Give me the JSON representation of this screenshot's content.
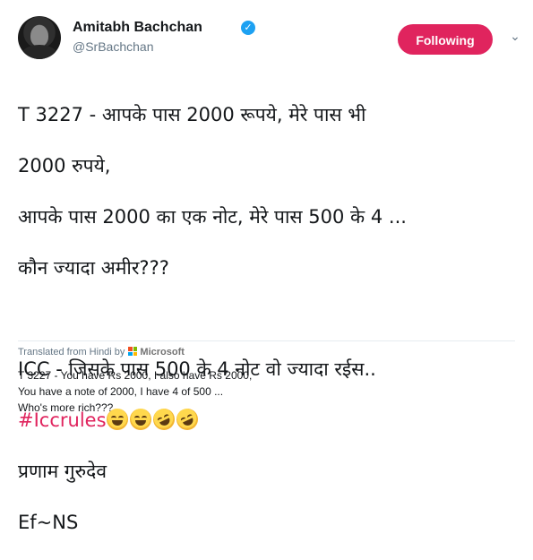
{
  "profile": {
    "name": "Amitabh Bachchan",
    "handle": "@SrBachchan",
    "follow_label": "Following"
  },
  "tweet": {
    "lines": [
      "T 3227 - आपके पास 2000 रूपये,  मेरे पास भी",
      "2000 रुपये,",
      "आपके पास 2000 का एक नोट, मेरे पास 500 के 4 ...",
      "कौन ज्यादा अमीर???",
      "ICC - जिसके पास 500 के 4 नोट वो ज्यादा रईस..",
      "प्रणाम गुरुदेव",
      "Ef~NS"
    ],
    "hashtag": "#Iccrules",
    "emojis": [
      "face-with-tears-of-joy",
      "face-with-tears-of-joy",
      "rolling-on-the-floor-laughing",
      "rolling-on-the-floor-laughing"
    ]
  },
  "translation": {
    "prefix": "Translated from Hindi by",
    "provider": "Microsoft",
    "lines": [
      "T 3227 - You have Rs 2000, I also have Rs 2000,",
      "You have a note of 2000, I have 4 of 500 ...",
      "Who's more rich???"
    ]
  },
  "colors": {
    "accent": "#e0245e",
    "verified": "#1da1f2",
    "muted": "#657786"
  },
  "icons": {
    "verified": "verified-badge-icon",
    "caret": "chevron-down-icon",
    "provider": "microsoft-logo-icon"
  }
}
